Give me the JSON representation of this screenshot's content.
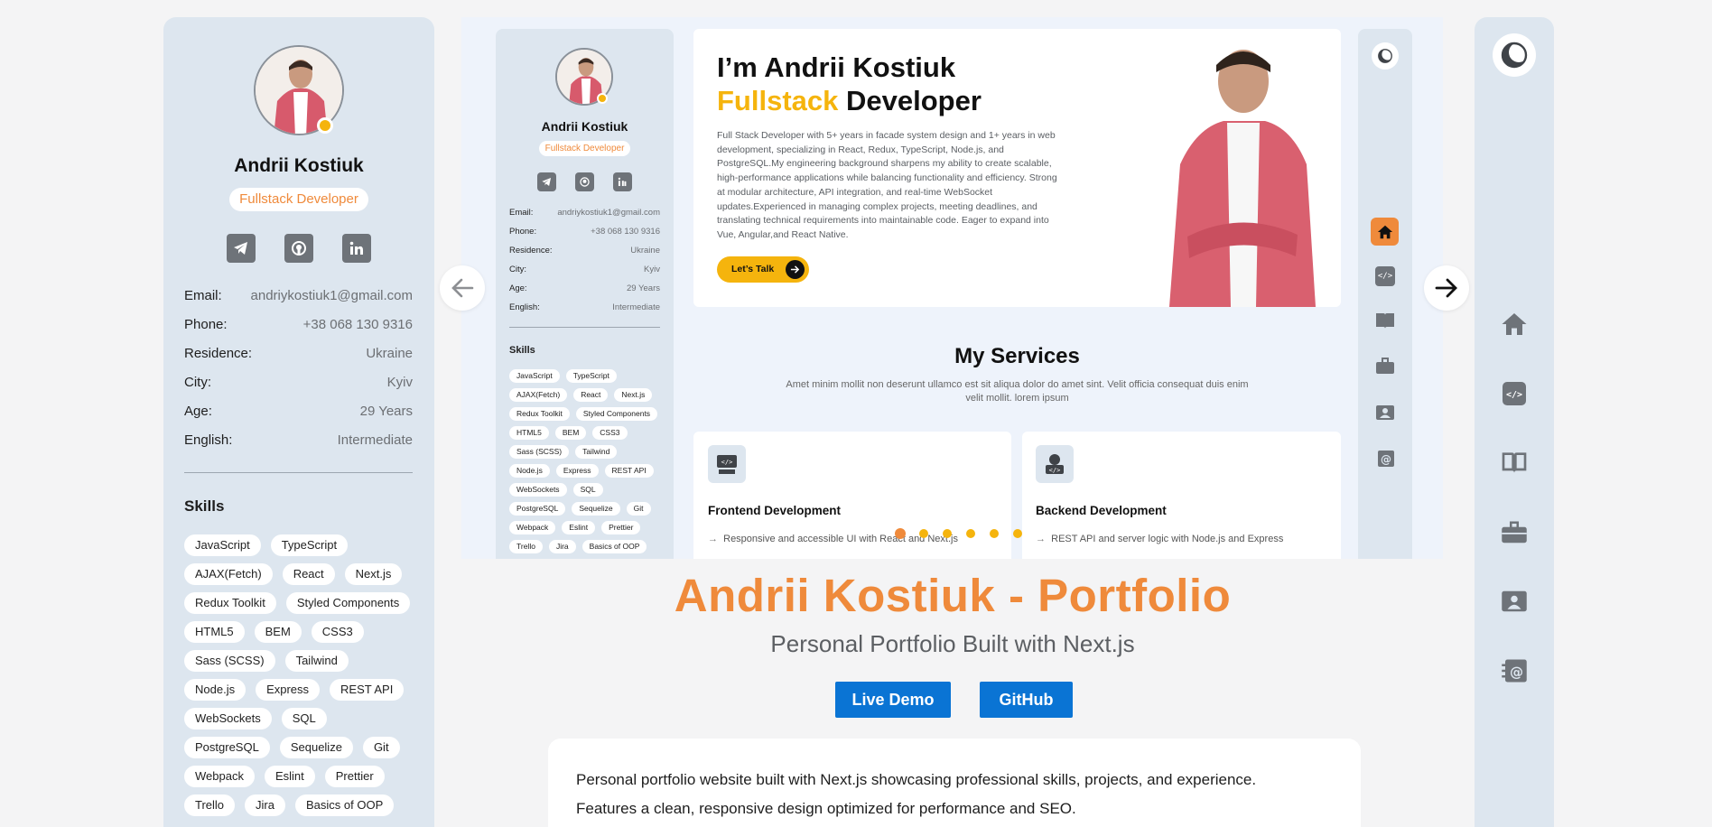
{
  "profile": {
    "name": "Andrii Kostiuk",
    "role": "Fullstack Developer",
    "social": [
      "telegram-icon",
      "github-icon",
      "linkedin-icon"
    ],
    "info": [
      {
        "label": "Email:",
        "value": "andriykostiuk1@gmail.com"
      },
      {
        "label": "Phone:",
        "value": "+38 068 130 9316"
      },
      {
        "label": "Residence:",
        "value": "Ukraine"
      },
      {
        "label": "City:",
        "value": "Kyiv"
      },
      {
        "label": "Age:",
        "value": "29 Years"
      },
      {
        "label": "English:",
        "value": "Intermediate"
      }
    ],
    "skills_title": "Skills",
    "skills": [
      "JavaScript",
      "TypeScript",
      "AJAX(Fetch)",
      "React",
      "Next.js",
      "Redux Toolkit",
      "Styled Components",
      "HTML5",
      "BEM",
      "CSS3",
      "Sass (SCSS)",
      "Tailwind",
      "Node.js",
      "Express",
      "REST API",
      "WebSockets",
      "SQL",
      "PostgreSQL",
      "Sequelize",
      "Git",
      "Webpack",
      "Eslint",
      "Prettier",
      "Trello",
      "Jira",
      "Basics of OOP"
    ]
  },
  "preview": {
    "hero": {
      "greeting": "I’m Andrii Kostiuk",
      "title_accent": "Fullstack",
      "title_rest": " Developer",
      "description": "Full Stack Developer with 5+ years in facade system design and 1+ years in web development, specializing in React, Redux, TypeScript, Node.js, and PostgreSQL.My engineering background sharpens my ability to create scalable, high-performance applications while balancing functionality and efficiency. Strong at modular architecture, API integration, and real-time WebSocket updates.Experienced in managing complex projects, meeting deadlines, and translating technical requirements into maintainable code. Eager to expand into Vue, Angular,and React Native.",
      "cta": "Let’s Talk"
    },
    "services": {
      "title": "My Services",
      "subtitle": "Amet minim mollit non deserunt ullamco est sit aliqua dolor do amet sint. Velit officia consequat duis enim velit mollit. lorem ipsum",
      "cards": [
        {
          "title": "Frontend Development",
          "text": "Responsive and accessible UI with React and Next.js"
        },
        {
          "title": "Backend Development",
          "text": "REST API and server logic with Node.js and Express"
        }
      ]
    },
    "carousel_dots": 6
  },
  "project": {
    "title": "Andrii Kostiuk - Portfolio",
    "subtitle": "Personal Portfolio Built with Next.js",
    "buttons": {
      "live_demo": "Live Demo",
      "github": "GitHub"
    },
    "description_lines": [
      "Personal portfolio website built with Next.js showcasing professional skills, projects, and experience.",
      "Features a clean, responsive design optimized for performance and SEO."
    ]
  },
  "nav": [
    "home-icon",
    "code-icon",
    "book-icon",
    "briefcase-icon",
    "contact-card-icon",
    "at-contact-icon"
  ],
  "colors": {
    "accent": "#ef8a3b",
    "yellow": "#f5b40d",
    "blue": "#0a74d4",
    "sidebar": "#dde6ef"
  }
}
